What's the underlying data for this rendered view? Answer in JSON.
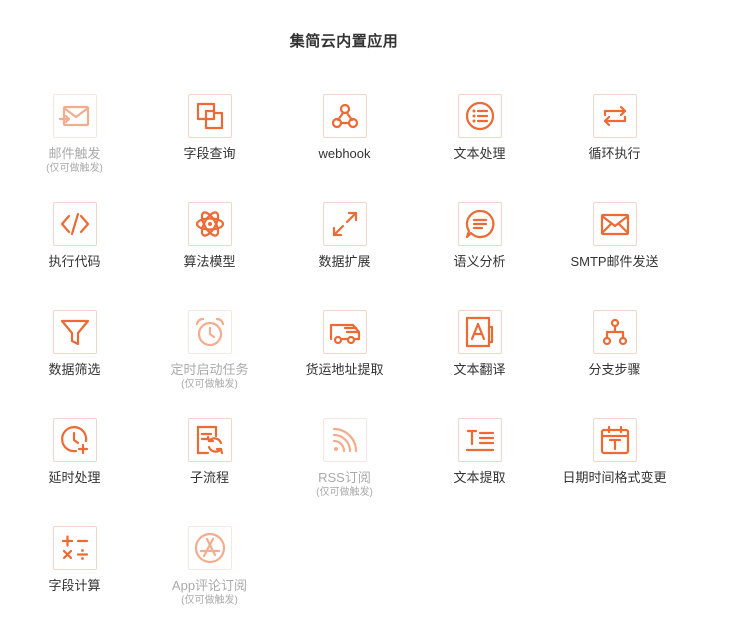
{
  "page_title": "集简云内置应用",
  "accent_color": "#ec6a34",
  "apps": [
    {
      "label": "邮件触发",
      "note": "(仅可做触发)",
      "icon": "mail-trigger-icon"
    },
    {
      "label": "字段查询",
      "note": "",
      "icon": "field-query-icon"
    },
    {
      "label": "webhook",
      "note": "",
      "icon": "webhook-icon"
    },
    {
      "label": "文本处理",
      "note": "",
      "icon": "list-circle-icon"
    },
    {
      "label": "循环执行",
      "note": "",
      "icon": "loop-icon"
    },
    {
      "label": "执行代码",
      "note": "",
      "icon": "code-icon"
    },
    {
      "label": "算法模型",
      "note": "",
      "icon": "atom-icon"
    },
    {
      "label": "数据扩展",
      "note": "",
      "icon": "expand-icon"
    },
    {
      "label": "语义分析",
      "note": "",
      "icon": "chat-bubble-icon"
    },
    {
      "label": "SMTP邮件发送",
      "note": "",
      "icon": "mail-icon"
    },
    {
      "label": "数据筛选",
      "note": "",
      "icon": "filter-icon"
    },
    {
      "label": "定时启动任务",
      "note": "(仅可做触发)",
      "icon": "alarm-clock-icon"
    },
    {
      "label": "货运地址提取",
      "note": "",
      "icon": "truck-icon"
    },
    {
      "label": "文本翻译",
      "note": "",
      "icon": "translate-icon"
    },
    {
      "label": "分支步骤",
      "note": "",
      "icon": "branch-icon"
    },
    {
      "label": "延时处理",
      "note": "",
      "icon": "clock-plus-icon"
    },
    {
      "label": "子流程",
      "note": "",
      "icon": "subflow-icon"
    },
    {
      "label": "RSS订阅",
      "note": "(仅可做触发)",
      "icon": "rss-icon"
    },
    {
      "label": "文本提取",
      "note": "",
      "icon": "text-extract-icon"
    },
    {
      "label": "日期时间格式变更",
      "note": "",
      "icon": "calendar-icon"
    },
    {
      "label": "字段计算",
      "note": "",
      "icon": "calculator-icon"
    },
    {
      "label": "App评论订阅",
      "note": "(仅可做触发)",
      "icon": "app-store-icon"
    }
  ]
}
